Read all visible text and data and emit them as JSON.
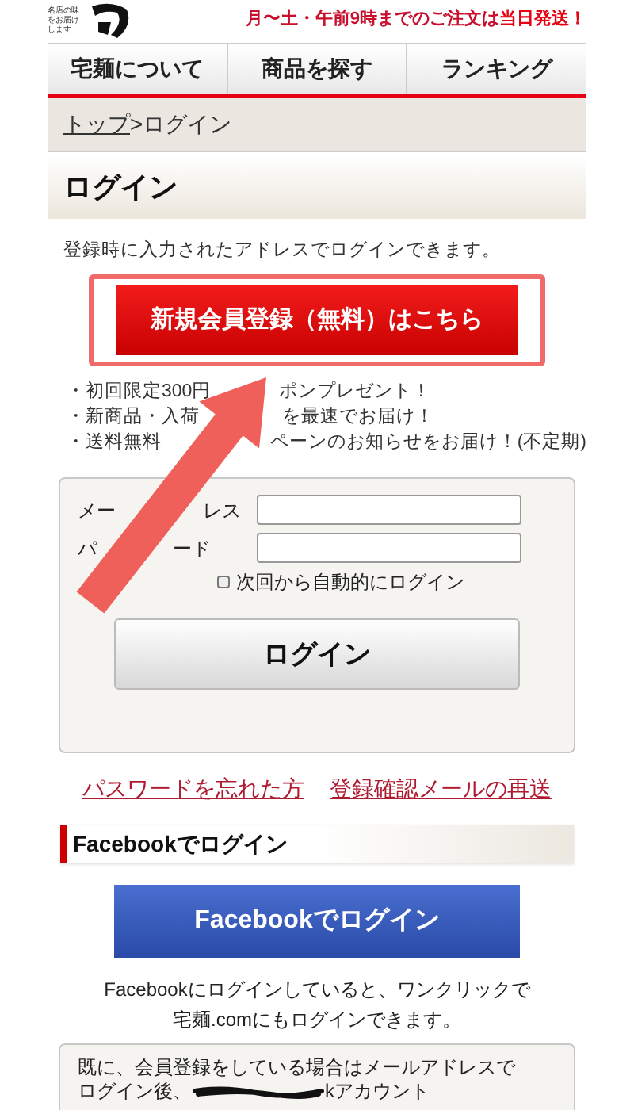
{
  "header": {
    "logo_tagline": "名店の味をお届けします",
    "notice": "月〜土・午前9時までのご注文は",
    "notice_emphasis": "当日発送！"
  },
  "nav": [
    {
      "label": "宅麺について"
    },
    {
      "label": "商品を探す"
    },
    {
      "label": "ランキング"
    }
  ],
  "breadcrumb": {
    "link": "トップ",
    "current": ">ログイン"
  },
  "page_title": "ログイン",
  "intro": "登録時に入力されたアドレスでログインできます。",
  "register_button": "新規会員登録（無料）はこちら",
  "benefits": [
    {
      "before": "・初回限定300円",
      "after": "ポンプレゼント！"
    },
    {
      "before": "・新商品・入荷",
      "after": "を最速でお届け！"
    },
    {
      "before": "・送料無料",
      "after": "ペーンのお知らせをお届け！(不定期)"
    }
  ],
  "login_form": {
    "email_label": {
      "before": "メー",
      "after": "レス"
    },
    "password_label": {
      "before": "パ",
      "after": "ード"
    },
    "auto_login": {
      "label": "次回から自動的にログイン",
      "checked": false
    },
    "submit": "ログイン"
  },
  "links": [
    "パスワードを忘れた方",
    "登録確認メールの再送"
  ],
  "facebook": {
    "heading": "Facebookでログイン",
    "button": "Facebookでログイン",
    "note": [
      "Facebookにログインしていると、ワンクリックで",
      "宅麺.comにもログインできます。"
    ]
  },
  "linked_note": {
    "line_1": "既に、会員登録をしている場合はメールアドレスで",
    "line_2_start": "ログイン後、",
    "line_2_end": "kアカウント"
  }
}
